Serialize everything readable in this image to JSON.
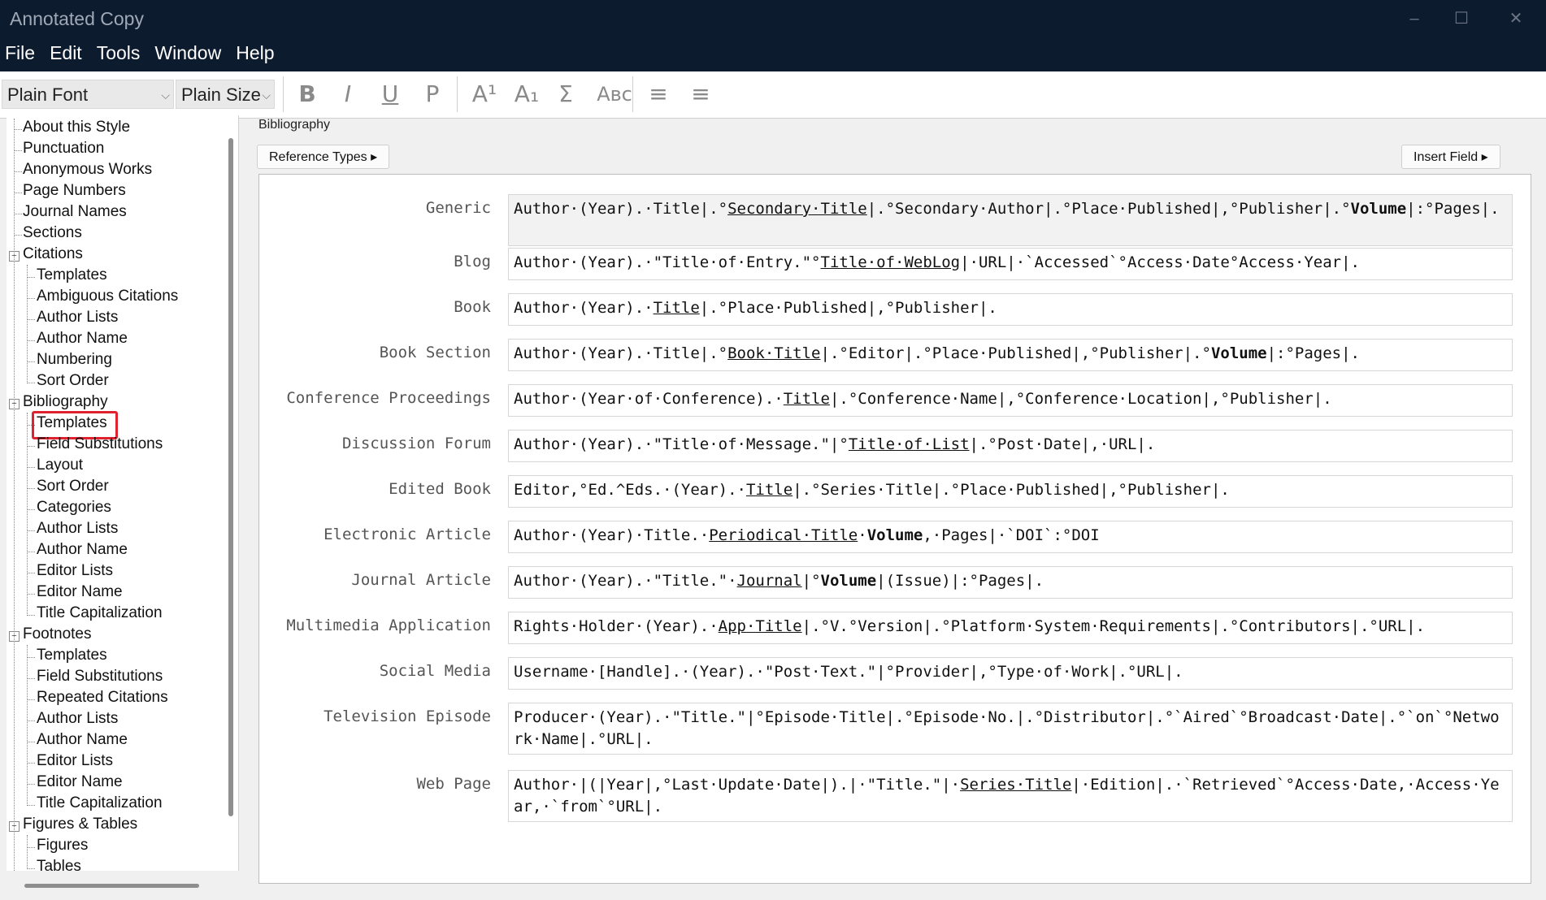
{
  "window": {
    "title": "Annotated Copy",
    "controls": [
      "–",
      "☐",
      "✕"
    ]
  },
  "menu": [
    "File",
    "Edit",
    "Tools",
    "Window",
    "Help"
  ],
  "toolbar": {
    "font_value": "Plain Font",
    "size_value": "Plain Size",
    "buttons": [
      "B",
      "I",
      "U",
      "P",
      "A¹",
      "A₁",
      "Σ",
      "Aʙᴄ",
      "≡",
      "≡"
    ]
  },
  "sidebar": {
    "items": [
      {
        "label": "About this Style",
        "level": 0
      },
      {
        "label": "Punctuation",
        "level": 0
      },
      {
        "label": "Anonymous Works",
        "level": 0
      },
      {
        "label": "Page Numbers",
        "level": 0
      },
      {
        "label": "Journal Names",
        "level": 0
      },
      {
        "label": "Sections",
        "level": 0
      },
      {
        "label": "Citations",
        "level": 0,
        "expandable": true
      },
      {
        "label": "Templates",
        "level": 1
      },
      {
        "label": "Ambiguous Citations",
        "level": 1
      },
      {
        "label": "Author Lists",
        "level": 1
      },
      {
        "label": "Author Name",
        "level": 1
      },
      {
        "label": "Numbering",
        "level": 1
      },
      {
        "label": "Sort Order",
        "level": 1
      },
      {
        "label": "Bibliography",
        "level": 0,
        "expandable": true
      },
      {
        "label": "Templates",
        "level": 1,
        "selected": true
      },
      {
        "label": "Field Substitutions",
        "level": 1
      },
      {
        "label": "Layout",
        "level": 1
      },
      {
        "label": "Sort Order",
        "level": 1
      },
      {
        "label": "Categories",
        "level": 1
      },
      {
        "label": "Author Lists",
        "level": 1
      },
      {
        "label": "Author Name",
        "level": 1
      },
      {
        "label": "Editor Lists",
        "level": 1
      },
      {
        "label": "Editor Name",
        "level": 1
      },
      {
        "label": "Title Capitalization",
        "level": 1
      },
      {
        "label": "Footnotes",
        "level": 0,
        "expandable": true
      },
      {
        "label": "Templates",
        "level": 1
      },
      {
        "label": "Field Substitutions",
        "level": 1
      },
      {
        "label": "Repeated Citations",
        "level": 1
      },
      {
        "label": "Author Lists",
        "level": 1
      },
      {
        "label": "Author Name",
        "level": 1
      },
      {
        "label": "Editor Lists",
        "level": 1
      },
      {
        "label": "Editor Name",
        "level": 1
      },
      {
        "label": "Title Capitalization",
        "level": 1
      },
      {
        "label": "Figures & Tables",
        "level": 0,
        "expandable": true
      },
      {
        "label": "Figures",
        "level": 1
      },
      {
        "label": "Tables",
        "level": 1
      }
    ]
  },
  "content": {
    "section_title": "Bibliography",
    "reference_types_button": "Reference Types ▸",
    "insert_field_button": "Insert Field ▸",
    "templates": [
      {
        "type": "Generic",
        "html": "Author·(Year).·Title|.°<u>Secondary·Title</u>|.°Secondary·Author|.°Place·Published|,°Publisher|.°<b>Volume</b>|:°Pages|.",
        "lines": 2,
        "selected": true
      },
      {
        "type": "Blog",
        "html": "Author·(Year).·\"Title·of·Entry.\"°<u>Title·of·WebLog</u>|·URL|·`Accessed`°Access·Date°Access·Year|.",
        "lines": 1
      },
      {
        "type": "Book",
        "html": "Author·(Year).·<u>Title</u>|.°Place·Published|,°Publisher|.",
        "lines": 1
      },
      {
        "type": "Book Section",
        "html": "Author·(Year).·Title|.°<u>Book·Title</u>|.°Editor|.°Place·Published|,°Publisher|.°<b>Volume</b>|:°Pages|.",
        "lines": 1
      },
      {
        "type": "Conference Proceedings",
        "html": "Author·(Year·of·Conference).·<u>Title</u>|.°Conference·Name|,°Conference·Location|,°Publisher|.",
        "lines": 1
      },
      {
        "type": "Discussion Forum",
        "html": "Author·(Year).·\"Title·of·Message.\"|°<u>Title·of·List</u>|.°Post·Date|,·URL|.",
        "lines": 1
      },
      {
        "type": "Edited Book",
        "html": "Editor,°Ed.^Eds.·(Year).·<u>Title</u>|.°Series·Title|.°Place·Published|,°Publisher|.",
        "lines": 1
      },
      {
        "type": "Electronic Article",
        "html": "Author·(Year)·Title.·<u>Periodical·Title</u>·<b>Volume</b>,·Pages|·`DOI`:°DOI",
        "lines": 1
      },
      {
        "type": "Journal Article",
        "html": "Author·(Year).·\"Title.\"·<u>Journal</u>|°<b>Volume</b>|(Issue)|:°Pages|.",
        "lines": 1
      },
      {
        "type": "Multimedia Application",
        "html": "Rights·Holder·(Year).·<u>App·Title</u>|.°V.°Version|.°Platform·System·Requirements|.°Contributors|.°URL|.",
        "lines": 1
      },
      {
        "type": "Social Media",
        "html": "Username·[Handle].·(Year).·\"Post·Text.\"|°Provider|,°Type·of·Work|.°URL|.",
        "lines": 1
      },
      {
        "type": "Television Episode",
        "html": "Producer·(Year).·\"Title.\"|°Episode·Title|.°Episode·No.|.°Distributor|.°`Aired`°Broadcast·Date|.°`on`°Network·Name|.°URL|.",
        "lines": 2
      },
      {
        "type": "Web Page",
        "html": "Author·|(|Year|,°Last·Update·Date|).|·\"Title.\"|·<u>Series·Title</u>|·Edition|.·`Retrieved`°Access·Date,·Access·Year,·`from`°URL|.",
        "lines": 2
      }
    ]
  }
}
